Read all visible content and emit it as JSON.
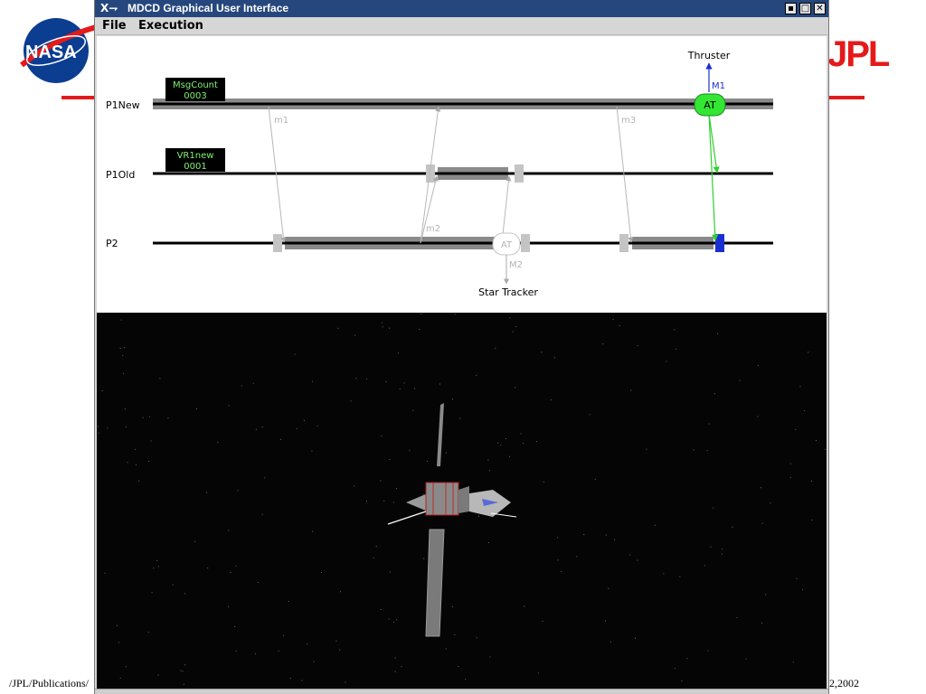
{
  "slide": {
    "logo_left_text": "NASA",
    "logo_right_text": "JPL",
    "footer_left": "/JPL/Publications/",
    "footer_right": "2,2002",
    "accent": "#e41a1a"
  },
  "window": {
    "title": "MDCD Graphical User Interface",
    "icon": "x-window-icon",
    "menus": [
      "File",
      "Execution"
    ],
    "controls": [
      "minimize-icon",
      "maximize-icon",
      "close-icon"
    ],
    "titlebar_color": "#26477d"
  },
  "diagram": {
    "processes": [
      "P1New",
      "P1Old",
      "P2"
    ],
    "counters": [
      {
        "label": "MsgCount",
        "value": "0003"
      },
      {
        "label": "VR1new",
        "value": "0001"
      }
    ],
    "messages": [
      "m1",
      "m2",
      "m3"
    ],
    "external_messages": [
      "M1",
      "M2"
    ],
    "acceptance_tests": [
      {
        "label": "AT",
        "state": "active",
        "color": "#33e633"
      },
      {
        "label": "AT",
        "state": "inactive",
        "color": "#ffffff"
      }
    ],
    "devices": [
      "Thruster",
      "Star Tracker"
    ]
  },
  "simulation": {
    "background": "#050505",
    "object": "spacecraft"
  }
}
